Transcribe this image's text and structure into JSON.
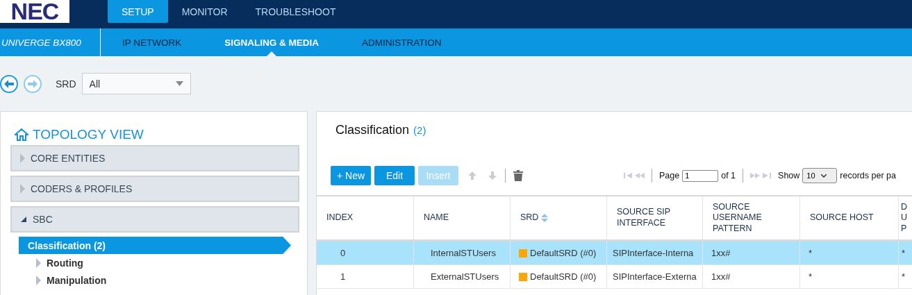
{
  "logo": "NEC",
  "top_tabs": [
    {
      "label": "SETUP",
      "selected": true
    },
    {
      "label": "MONITOR",
      "selected": false
    },
    {
      "label": "TROUBLESHOOT",
      "selected": false
    }
  ],
  "product": "UNIVERGE BX800",
  "sub_tabs": [
    {
      "label": "IP NETWORK",
      "selected": false
    },
    {
      "label": "SIGNALING & MEDIA",
      "selected": true
    },
    {
      "label": "ADMINISTRATION",
      "selected": false
    }
  ],
  "srd_filter": {
    "label": "SRD",
    "value": "All"
  },
  "sidebar": {
    "title": "TOPOLOGY VIEW",
    "sections": [
      {
        "label": "CORE ENTITIES",
        "expanded": false
      },
      {
        "label": "CODERS & PROFILES",
        "expanded": false
      },
      {
        "label": "SBC",
        "expanded": true,
        "children": [
          {
            "label": "Classification (2)",
            "selected": true
          },
          {
            "label": "Routing",
            "selected": false
          },
          {
            "label": "Manipulation",
            "selected": false
          }
        ]
      }
    ]
  },
  "content": {
    "title": "Classification",
    "count": "(2)",
    "buttons": [
      {
        "label": "+ New",
        "disabled": false
      },
      {
        "label": "Edit",
        "disabled": false
      },
      {
        "label": "Insert",
        "disabled": true
      }
    ],
    "pager": {
      "page_label": "Page",
      "page": "1",
      "of": "of 1",
      "show_label": "Show",
      "page_size": "10",
      "records_label": "records per pa"
    },
    "table": {
      "columns": [
        {
          "label": "INDEX",
          "sorted": false
        },
        {
          "label": "NAME",
          "sorted": false
        },
        {
          "label": "SRD",
          "sorted": true
        },
        {
          "label": "SOURCE SIP INTERFACE",
          "sorted": false
        },
        {
          "label": "SOURCE USERNAME PATTERN",
          "sorted": false
        },
        {
          "label": "SOURCE HOST",
          "sorted": false
        },
        {
          "label": "D U P",
          "sorted": false
        }
      ],
      "rows": [
        {
          "selected": true,
          "color": "#ffa500",
          "cells": [
            "0",
            "InternalSTUsers",
            "DefaultSRD (#0)",
            "SIPInterface-Interna",
            "1xx#",
            "*",
            "*"
          ]
        },
        {
          "selected": false,
          "color": "#ffa500",
          "cells": [
            "1",
            "ExternalSTUsers",
            "DefaultSRD (#0)",
            "SIPInterface-Externa",
            "1xx#",
            "*",
            "*"
          ]
        }
      ]
    }
  }
}
